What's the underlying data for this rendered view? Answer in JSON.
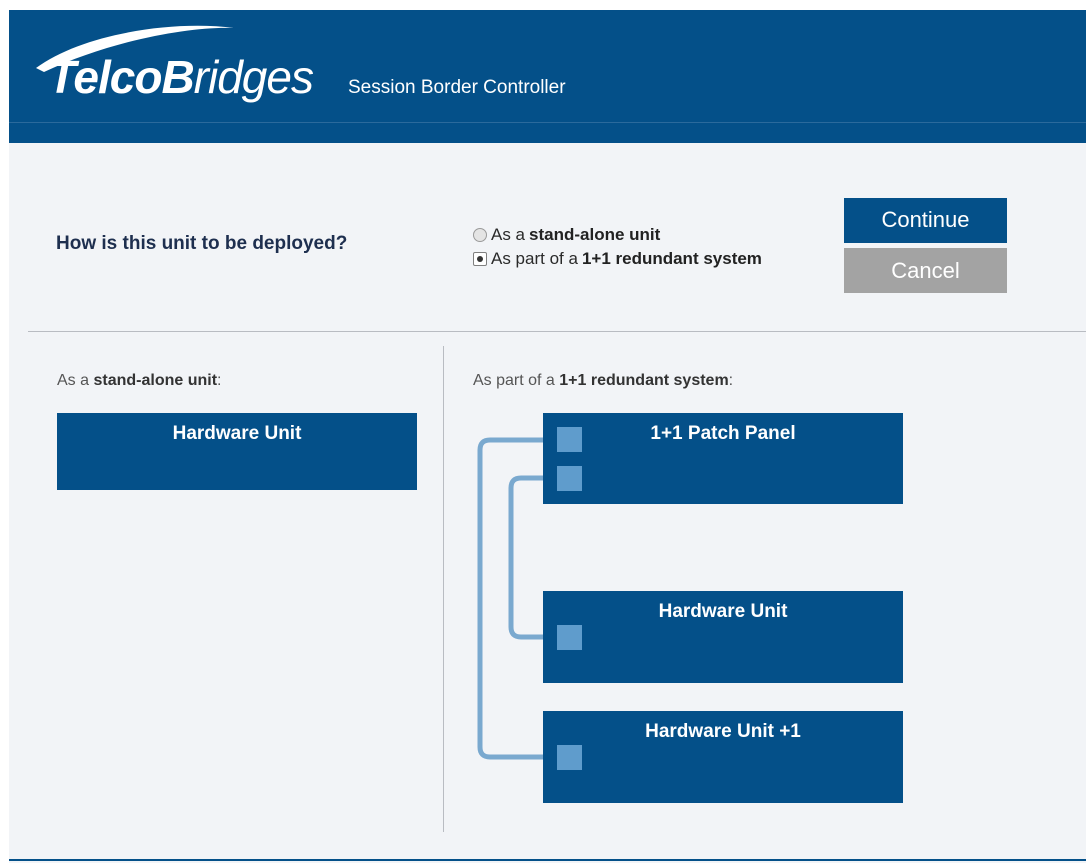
{
  "header": {
    "logo_text_bold": "TelcoB",
    "logo_text_light": "ridges",
    "logo_bold_prefix": "Telco",
    "logo_b": "B",
    "app_title": "Session Border Controller"
  },
  "deployment": {
    "question": "How is this unit to be deployed?",
    "options": [
      {
        "prefix": "As a ",
        "bold": "stand-alone unit",
        "selected": false
      },
      {
        "prefix": "As part of a ",
        "bold": "1+1 redundant system",
        "selected": true
      }
    ],
    "continue_label": "Continue",
    "cancel_label": "Cancel"
  },
  "standalone": {
    "label_prefix": "As a ",
    "label_bold": "stand-alone unit",
    "label_suffix": ":",
    "unit_label": "Hardware Unit"
  },
  "redundant": {
    "label_prefix": "As part of a ",
    "label_bold": "1+1 redundant system",
    "label_suffix": ":",
    "patch_panel_label": "1+1 Patch Panel",
    "unit_label": "Hardware Unit",
    "unit_plus1_label": "Hardware Unit +1"
  },
  "colors": {
    "brand_blue": "#045089",
    "port_blue": "#5f9ccc",
    "cancel_gray": "#a3a3a3",
    "background": "#f2f4f7"
  }
}
